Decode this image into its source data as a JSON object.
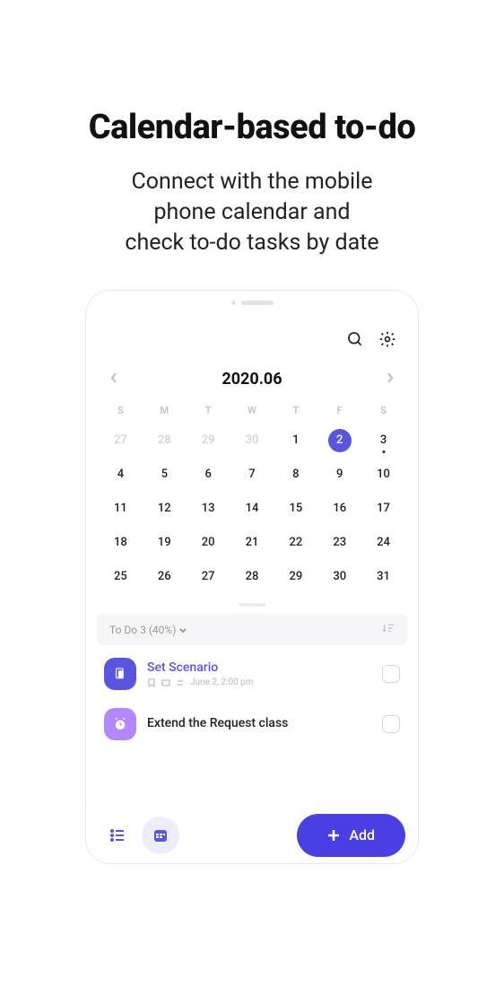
{
  "hero": {
    "title": "Calendar-based to-do",
    "subtitle": "Connect with the mobile\nphone calendar and\ncheck to-do tasks by date"
  },
  "calendar": {
    "month_label": "2020.06",
    "dow": [
      "S",
      "M",
      "T",
      "W",
      "T",
      "F",
      "S"
    ],
    "weeks": [
      [
        {
          "d": "27",
          "out": true
        },
        {
          "d": "28",
          "out": true
        },
        {
          "d": "29",
          "out": true
        },
        {
          "d": "30",
          "out": true
        },
        {
          "d": "1"
        },
        {
          "d": "2",
          "sel": true
        },
        {
          "d": "3",
          "mark": true
        }
      ],
      [
        {
          "d": "4"
        },
        {
          "d": "5"
        },
        {
          "d": "6"
        },
        {
          "d": "7"
        },
        {
          "d": "8"
        },
        {
          "d": "9"
        },
        {
          "d": "10"
        }
      ],
      [
        {
          "d": "11"
        },
        {
          "d": "12"
        },
        {
          "d": "13"
        },
        {
          "d": "14"
        },
        {
          "d": "15"
        },
        {
          "d": "16"
        },
        {
          "d": "17"
        }
      ],
      [
        {
          "d": "18"
        },
        {
          "d": "19"
        },
        {
          "d": "20"
        },
        {
          "d": "21"
        },
        {
          "d": "22"
        },
        {
          "d": "23"
        },
        {
          "d": "24"
        }
      ],
      [
        {
          "d": "25"
        },
        {
          "d": "26"
        },
        {
          "d": "27"
        },
        {
          "d": "28"
        },
        {
          "d": "29"
        },
        {
          "d": "30"
        },
        {
          "d": "31"
        }
      ]
    ]
  },
  "filter": {
    "label": "To Do 3 (40%)"
  },
  "tasks": [
    {
      "title": "Set Scenario",
      "meta_text": "June 2, 2:00 pm",
      "icon": "doc"
    },
    {
      "title": "Extend the Request class",
      "meta_text": "",
      "icon": "alarm"
    }
  ],
  "bottom": {
    "add_label": "Add"
  }
}
